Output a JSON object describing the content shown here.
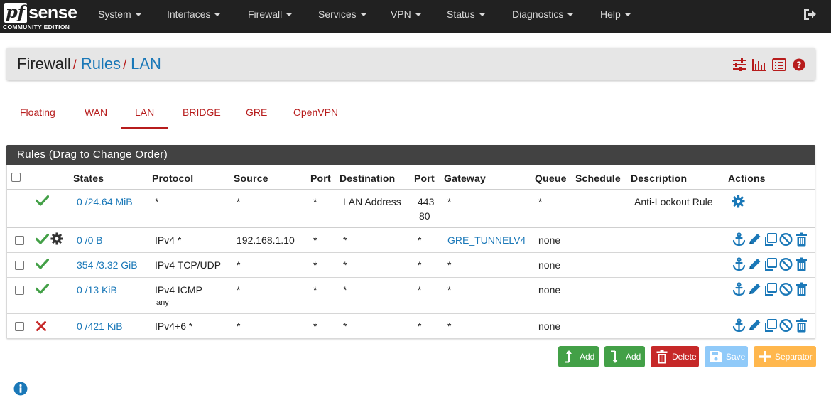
{
  "brand": {
    "name_pf": "pf",
    "name_rest": "sense",
    "edition": "COMMUNITY EDITION"
  },
  "nav": {
    "items": [
      "System",
      "Interfaces",
      "Firewall",
      "Services",
      "VPN",
      "Status",
      "Diagnostics",
      "Help"
    ],
    "logout_icon": "sign-out-icon"
  },
  "breadcrumb": {
    "root": "Firewall",
    "sep": "/",
    "level2": "Rules",
    "level3": "LAN"
  },
  "header_icons": [
    "sliders-icon",
    "bar-chart-icon",
    "list-alt-icon",
    "question-circle-icon"
  ],
  "tabs": {
    "items": [
      "Floating",
      "WAN",
      "LAN",
      "BRIDGE",
      "GRE",
      "OpenVPN"
    ],
    "active": "LAN"
  },
  "panel": {
    "title": "Rules (Drag to Change Order)"
  },
  "columns": [
    "States",
    "Protocol",
    "Source",
    "Port",
    "Destination",
    "Port",
    "Gateway",
    "Queue",
    "Schedule",
    "Description",
    "Actions"
  ],
  "rows": [
    {
      "status": "pass",
      "states": "0 /24.64 MiB",
      "protocol": "*",
      "protocol_sub": "",
      "source": "*",
      "sport": "*",
      "destination": "LAN Address",
      "dport": "443",
      "dport2": "80",
      "gateway": "*",
      "queue": "*",
      "schedule": "",
      "description": "Anti-Lockout Rule"
    },
    {
      "status": "pass",
      "states": "0 /0 B",
      "protocol": "IPv4 *",
      "protocol_sub": "",
      "source": "192.168.1.10",
      "sport": "*",
      "destination": "*",
      "dport": "*",
      "dport2": "",
      "gateway": "GRE_TUNNELV4",
      "queue": "none",
      "schedule": "",
      "description": ""
    },
    {
      "status": "pass",
      "states": "354 /3.32 GiB",
      "protocol": "IPv4 TCP/UDP",
      "protocol_sub": "",
      "source": "*",
      "sport": "*",
      "destination": "*",
      "dport": "*",
      "dport2": "",
      "gateway": "*",
      "queue": "none",
      "schedule": "",
      "description": ""
    },
    {
      "status": "pass",
      "states": "0 /13 KiB",
      "protocol": "IPv4 ICMP",
      "protocol_sub": "any",
      "source": "*",
      "sport": "*",
      "destination": "*",
      "dport": "*",
      "dport2": "",
      "gateway": "*",
      "queue": "none",
      "schedule": "",
      "description": ""
    },
    {
      "status": "block",
      "states": "0 /421 KiB",
      "protocol": "IPv4+6 *",
      "protocol_sub": "",
      "source": "*",
      "sport": "*",
      "destination": "*",
      "dport": "*",
      "dport2": "",
      "gateway": "*",
      "queue": "none",
      "schedule": "",
      "description": ""
    }
  ],
  "buttons": {
    "add_top": "Add",
    "add_bottom": "Add",
    "delete": "Delete",
    "save": "Save",
    "separator": "Separator"
  },
  "colors": {
    "accent_red": "#b71c1c",
    "link_blue": "#1a78b8",
    "pass_green": "#43a047",
    "btn_green": "#43a047",
    "btn_red": "#c62828",
    "btn_blue": "#90caf9",
    "btn_orange": "#ffb74d"
  }
}
